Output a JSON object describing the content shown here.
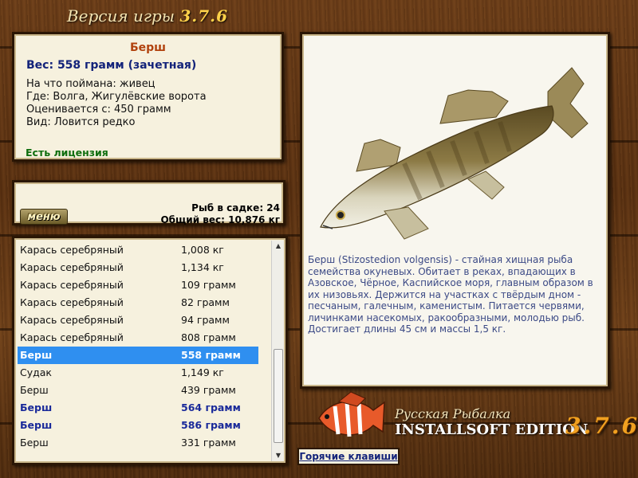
{
  "header": {
    "version_label": "Версия игры",
    "version_number": "3.7.6"
  },
  "catch": {
    "name": "Берш",
    "weight": "Вес: 558 грамм (зачетная)",
    "bait": "На что поймана: живец",
    "location": "Где: Волга, Жигулёвские ворота",
    "threshold": "Оценивается с: 450 грамм",
    "rarity": "Вид: Ловится редко",
    "license": "Есть лицензия"
  },
  "cage": {
    "menu_label": "меню",
    "count": "Рыб в садке: 24",
    "total_weight": "Общий вес: 10,876 кг"
  },
  "list": {
    "rows": [
      {
        "name": "Карась серебряный",
        "weight": "1,008 кг",
        "style": "normal"
      },
      {
        "name": "Карась серебряный",
        "weight": "1,134 кг",
        "style": "normal"
      },
      {
        "name": "Карась серебряный",
        "weight": "109 грамм",
        "style": "normal"
      },
      {
        "name": "Карась серебряный",
        "weight": "82 грамм",
        "style": "normal"
      },
      {
        "name": "Карась серебряный",
        "weight": "94 грамм",
        "style": "normal"
      },
      {
        "name": "Карась серебряный",
        "weight": "808 грамм",
        "style": "normal"
      },
      {
        "name": "Берш",
        "weight": "558 грамм",
        "style": "selected"
      },
      {
        "name": "Судак",
        "weight": "1,149 кг",
        "style": "normal"
      },
      {
        "name": "Берш",
        "weight": "439 грамм",
        "style": "normal"
      },
      {
        "name": "Берш",
        "weight": "564 грамм",
        "style": "bold"
      },
      {
        "name": "Берш",
        "weight": "586 грамм",
        "style": "bold"
      },
      {
        "name": "Берш",
        "weight": "331 грамм",
        "style": "normal"
      }
    ]
  },
  "description": "Берш (Stizostedion volgensis) - стайная хищная рыба семейства окуневых. Обитает в реках, впадающих в Азовское, Чёрное, Каспийское моря, главным образом в их низовьях. Держится на участках с твёрдым дном - песчаным, галечным, каменистым. Питается червями, личинками насекомых, ракообразными, молодью рыб. Достигает длины 45 см и массы 1,5 кг.",
  "brand": {
    "title": "Русская Рыбалка",
    "edition": "INSTALLSOFT EDITION",
    "version": "3.7.6"
  },
  "hotkeys_label": "Горячие клавиши",
  "colors": {
    "fish_name": "#b1420d",
    "weight": "#13237a",
    "license": "#0e6e0e",
    "selection": "#2f8ff0",
    "description": "#3c4a86"
  }
}
